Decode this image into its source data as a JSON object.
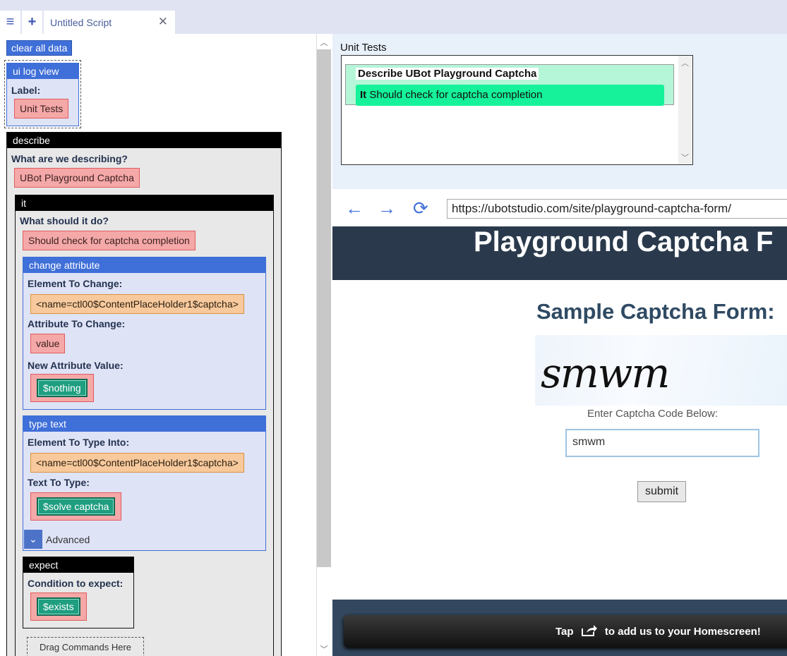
{
  "tabs": {
    "menu_icon": "≡",
    "add_icon": "+",
    "active_label": "Untitled Script",
    "close_icon": "✕"
  },
  "left": {
    "clear_button": "clear all data",
    "ui_log_view": {
      "title": "ui log view",
      "label_caption": "Label:",
      "label_value": "Unit Tests"
    },
    "describe": {
      "title": "describe",
      "question": "What are we describing?",
      "value": "UBot Playground Captcha"
    },
    "it": {
      "title": "it",
      "question": "What should it do?",
      "value": "Should check for captcha completion"
    },
    "change_attribute": {
      "title": "change attribute",
      "element_label": "Element To Change:",
      "element_value": "<name=ctl00$ContentPlaceHolder1$captcha>",
      "attr_label": "Attribute To Change:",
      "attr_value": "value",
      "new_label": "New Attribute Value:",
      "new_value": "$nothing"
    },
    "type_text": {
      "title": "type text",
      "element_label": "Element To Type Into:",
      "element_value": "<name=ctl00$ContentPlaceHolder1$captcha>",
      "text_label": "Text To Type:",
      "text_value": "$solve captcha",
      "advanced_label": "Advanced"
    },
    "expect": {
      "title": "expect",
      "condition_label": "Condition to expect:",
      "condition_value": "$exists"
    },
    "drag_here": "Drag Commands Here"
  },
  "unit_tests": {
    "title": "Unit Tests",
    "describe_legend": "Describe UBot Playground Captcha",
    "it_prefix": "It",
    "it_text": "Should check for captcha completion"
  },
  "browser": {
    "url": "https://ubotstudio.com/site/playground-captcha-form/",
    "hero_title": "Playground Captcha F",
    "form_title": "Sample Captcha Form:",
    "captcha_text": "smwm",
    "enter_label": "Enter Captcha Code Below:",
    "input_value": "smwm",
    "submit_label": "submit",
    "toast_tap": "Tap",
    "toast_rest": "to add us to your Homescreen!"
  }
}
